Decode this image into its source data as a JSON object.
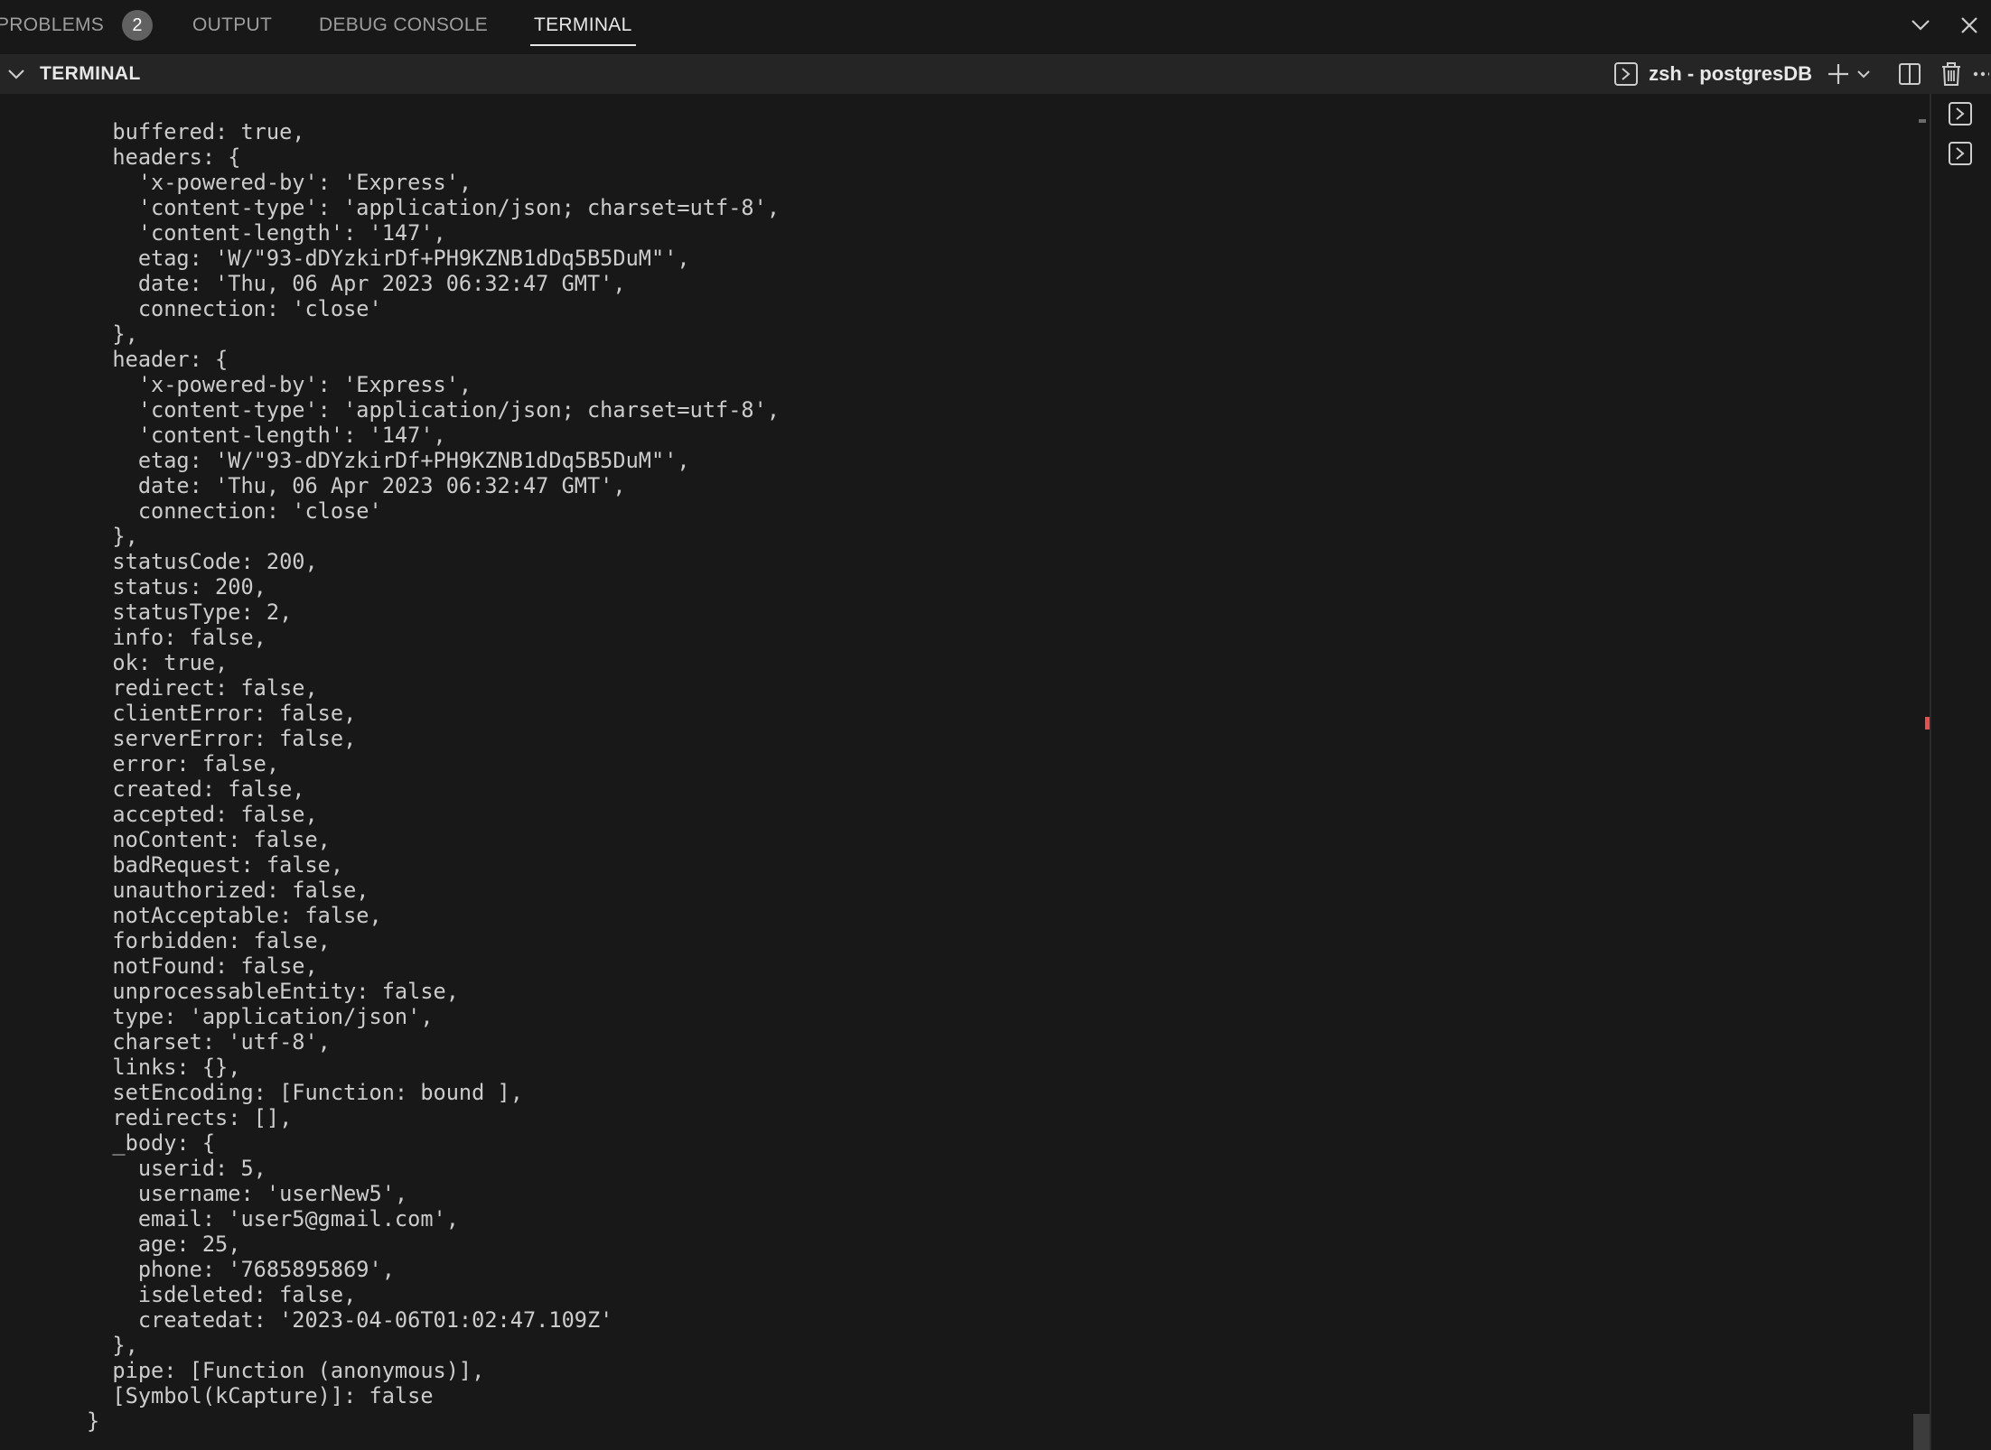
{
  "tabs": [
    {
      "label": "PROBLEMS",
      "badge": "2"
    },
    {
      "label": "OUTPUT"
    },
    {
      "label": "DEBUG CONSOLE"
    },
    {
      "label": "TERMINAL",
      "active": true
    }
  ],
  "terminal_header": {
    "title": "TERMINAL",
    "shell": "zsh - postgresDB"
  },
  "icons": {
    "collapse": "chevron-down-icon",
    "close": "close-icon",
    "shell": "terminal-icon",
    "new_terminal": "plus-icon",
    "launch_profile": "chevron-down-icon",
    "split": "split-terminal-icon",
    "kill": "trash-icon",
    "more": "ellipsis-icon",
    "sidebar_terminals": [
      "terminal-icon",
      "terminal-icon"
    ]
  },
  "terminal_output": "  buffered: true,\n  headers: {\n    'x-powered-by': 'Express',\n    'content-type': 'application/json; charset=utf-8',\n    'content-length': '147',\n    etag: 'W/\"93-dDYzkirDf+PH9KZNB1dDq5B5DuM\"',\n    date: 'Thu, 06 Apr 2023 06:32:47 GMT',\n    connection: 'close'\n  },\n  header: {\n    'x-powered-by': 'Express',\n    'content-type': 'application/json; charset=utf-8',\n    'content-length': '147',\n    etag: 'W/\"93-dDYzkirDf+PH9KZNB1dDq5B5DuM\"',\n    date: 'Thu, 06 Apr 2023 06:32:47 GMT',\n    connection: 'close'\n  },\n  statusCode: 200,\n  status: 200,\n  statusType: 2,\n  info: false,\n  ok: true,\n  redirect: false,\n  clientError: false,\n  serverError: false,\n  error: false,\n  created: false,\n  accepted: false,\n  noContent: false,\n  badRequest: false,\n  unauthorized: false,\n  notAcceptable: false,\n  forbidden: false,\n  notFound: false,\n  unprocessableEntity: false,\n  type: 'application/json',\n  charset: 'utf-8',\n  links: {},\n  setEncoding: [Function: bound ],\n  redirects: [],\n  _body: {\n    userid: 5,\n    username: 'userNew5',\n    email: 'user5@gmail.com',\n    age: 25,\n    phone: '7685895869',\n    isdeleted: false,\n    createdat: '2023-04-06T01:02:47.109Z'\n  },\n  pipe: [Function (anonymous)],\n  [Symbol(kCapture)]: false\n}"
}
